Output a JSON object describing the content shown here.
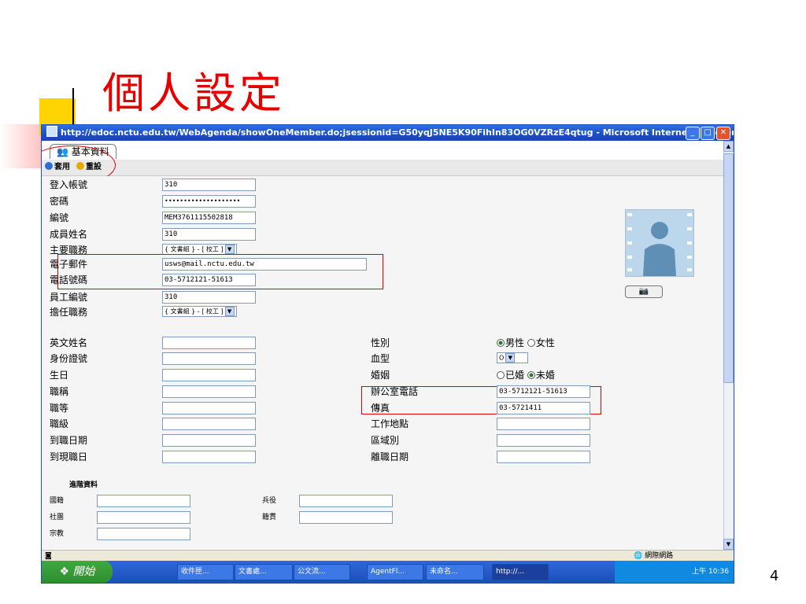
{
  "slide": {
    "title": "個人設定",
    "page_number": "4"
  },
  "window": {
    "title": "http://edoc.nctu.edu.tw/WebAgenda/showOneMember.do;jsessionid=G50yqJ5NE5K90FihIn83OG0VZRzE4qtug - Microsoft Internet Explorer",
    "tab_label": "基本資料",
    "toolbar": {
      "apply_label": "套用",
      "reset_label": "重設"
    },
    "colors": {
      "title_bar": "#1c4fc8",
      "annotation": "#e00000"
    }
  },
  "form": {
    "account": {
      "label": "登入帳號",
      "value": "310"
    },
    "password": {
      "label": "密碼",
      "value": "••••••••••••••••••••"
    },
    "serial": {
      "label": "編號",
      "value": "MEM3761115502818"
    },
    "member_name": {
      "label": "成員姓名",
      "value": "310"
    },
    "main_role": {
      "label": "主要職務",
      "value": "{ 文書組 } - [ 校工 ]"
    },
    "email": {
      "label": "電子郵件",
      "value": "usws@mail.nctu.edu.tw"
    },
    "phone": {
      "label": "電話號碼",
      "value": "03-5712121-51613"
    },
    "employee_no": {
      "label": "員工編號",
      "value": "310"
    },
    "assigned_role": {
      "label": "擔任職務",
      "value": "{ 文書組 } - [ 校工 ]"
    },
    "english_name": {
      "label": "英文姓名",
      "value": ""
    },
    "id_number": {
      "label": "身份證號",
      "value": ""
    },
    "birthday": {
      "label": "生日",
      "value": ""
    },
    "title_name": {
      "label": "職稱",
      "value": ""
    },
    "rank": {
      "label": "職等",
      "value": ""
    },
    "grade": {
      "label": "職級",
      "value": ""
    },
    "arrival_date": {
      "label": "到職日期",
      "value": ""
    },
    "current_date": {
      "label": "到現職日",
      "value": ""
    },
    "gender": {
      "label": "性別",
      "option_male": "男性",
      "option_female": "女性",
      "selected": "男性"
    },
    "blood_type": {
      "label": "血型",
      "value": "O"
    },
    "marriage": {
      "label": "婚姻",
      "option_married": "已婚",
      "option_single": "未婚",
      "selected": "未婚"
    },
    "office_phone": {
      "label": "辦公室電話",
      "value": "03-5712121-51613"
    },
    "fax": {
      "label": "傳真",
      "value": "03-5721411"
    },
    "work_place": {
      "label": "工作地點",
      "value": ""
    },
    "area": {
      "label": "區域別",
      "value": ""
    },
    "leave_date": {
      "label": "離職日期",
      "value": ""
    }
  },
  "advanced": {
    "heading": "進階資料",
    "nationality": {
      "label": "國籍",
      "value": ""
    },
    "military": {
      "label": "兵役",
      "value": ""
    },
    "community": {
      "label": "社團",
      "value": ""
    },
    "hometown": {
      "label": "籍貫",
      "value": ""
    },
    "religion": {
      "label": "宗教",
      "value": ""
    }
  },
  "statusbar": {
    "zone": "網際網路"
  },
  "taskbar": {
    "start_label": "開始",
    "items": [
      "收件匣...",
      "文書處...",
      "公文流...",
      "AgentFl...",
      "未命名...",
      "http://..."
    ],
    "clock": "上午 10:36"
  },
  "icons": [
    "ie-icon",
    "minimize-icon",
    "maximize-icon",
    "close-icon",
    "users-icon",
    "apply-icon",
    "reset-icon",
    "camera-icon",
    "avatar-photo",
    "scroll-up-icon",
    "scroll-down-icon",
    "globe-icon",
    "windows-logo-icon"
  ]
}
